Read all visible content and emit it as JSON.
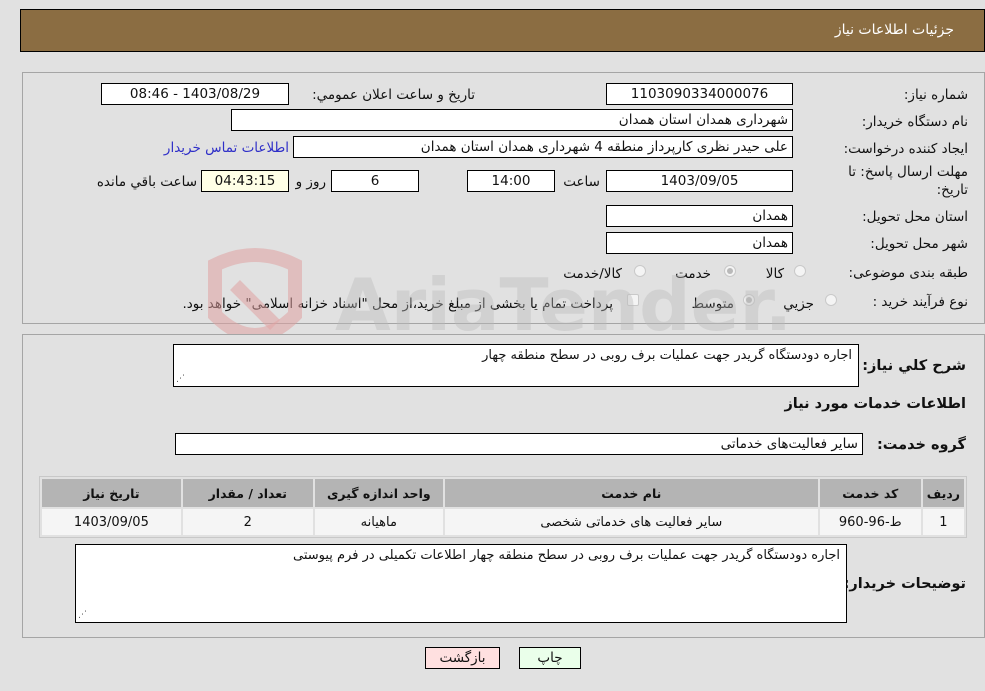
{
  "header": {
    "title": "جزئیات اطلاعات نیاز"
  },
  "form": {
    "need_number": {
      "label": "شماره نیاز:",
      "value": "1103090334000076"
    },
    "announce_datetime": {
      "label": "تاریخ و ساعت اعلان عمومي:",
      "value": "1403/08/29 - 08:46"
    },
    "buyer_org": {
      "label": "نام دستگاه خريدار:",
      "value": "شهرداری همدان استان همدان"
    },
    "requester": {
      "label": "ایجاد کننده درخواست:",
      "value": "علی حیدر نظری کارپرداز منطقه 4 شهرداری همدان استان همدان"
    },
    "contact_link": "اطلاعات تماس خريدار",
    "deadline": {
      "label_line1": "مهلت ارسال پاسخ: تا",
      "label_line2": "تاریخ:",
      "date": "1403/09/05",
      "time_label": "ساعت",
      "time": "14:00",
      "days": "6",
      "days_label": "روز و",
      "remaining": "04:43:15",
      "remaining_label": "ساعت باقي مانده"
    },
    "delivery_province": {
      "label": "استان محل تحویل:",
      "value": "همدان"
    },
    "delivery_city": {
      "label": "شهر محل تحویل:",
      "value": "همدان"
    },
    "category": {
      "label": "طبقه بندی موضوعی:",
      "options": [
        "کالا",
        "خدمت",
        "کالا/خدمت"
      ],
      "selected": "خدمت"
    },
    "purchase_type": {
      "label": "نوع فرآیند خرید :",
      "options": [
        "جزيي",
        "متوسط"
      ],
      "selected": "متوسط",
      "treasury_note": "پرداخت تمام یا بخشی از مبلغ خرید،از محل \"اسناد خزانه اسلامی\" خواهد بود."
    }
  },
  "details": {
    "general_desc_label": "شرح کلي نياز:",
    "general_desc": "اجاره دودستگاه گریدر جهت عملیات برف روبی در سطح منطقه چهار",
    "services_title": "اطلاعات خدمات مورد نياز",
    "service_group_label": "گروه خدمت:",
    "service_group": "سایر فعالیت‌های خدماتی",
    "table": {
      "headers": [
        "رديف",
        "کد خدمت",
        "نام خدمت",
        "واحد اندازه گيری",
        "تعداد / مقدار",
        "تاريخ نياز"
      ],
      "rows": [
        [
          "1",
          "ط-96-960",
          "سایر فعالیت های خدماتی شخصی",
          "ماهیانه",
          "2",
          "1403/09/05"
        ]
      ]
    },
    "buyer_notes_label": "توضيحات خريدار:",
    "buyer_notes": "اجاره دودستگاه گریدر جهت عملیات برف روبی در سطح منطقه چهار اطلاعات تکمیلی در فرم پیوستی"
  },
  "buttons": {
    "print": "چاپ",
    "back": "بازگشت"
  },
  "watermark": {
    "text": "AriaTender.neT"
  },
  "colors": {
    "header_bg": "#8b6d42",
    "print_bg": "#eaffea",
    "back_bg": "#ffe0e0",
    "link": "#2f2fc8"
  }
}
